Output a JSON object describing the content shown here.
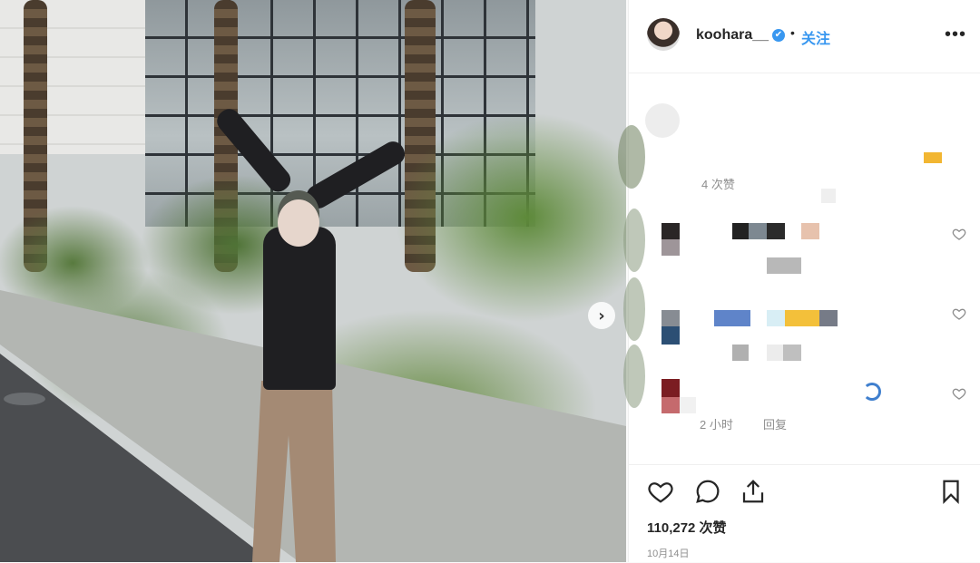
{
  "header": {
    "username": "koohara__",
    "verified_icon": "✔",
    "separator": "•",
    "follow_label": "关注",
    "more_icon": "•••"
  },
  "photo": {
    "next_icon": "›"
  },
  "comments": {
    "first_meta": "4 次赞",
    "last_meta": "2 小时",
    "reply_label": "回复"
  },
  "actions": {
    "likes": "110,272 次赞",
    "date": "10月14日"
  },
  "colors": {
    "accent": "#3897f0",
    "text": "#262626",
    "muted": "#8e8e8e"
  }
}
